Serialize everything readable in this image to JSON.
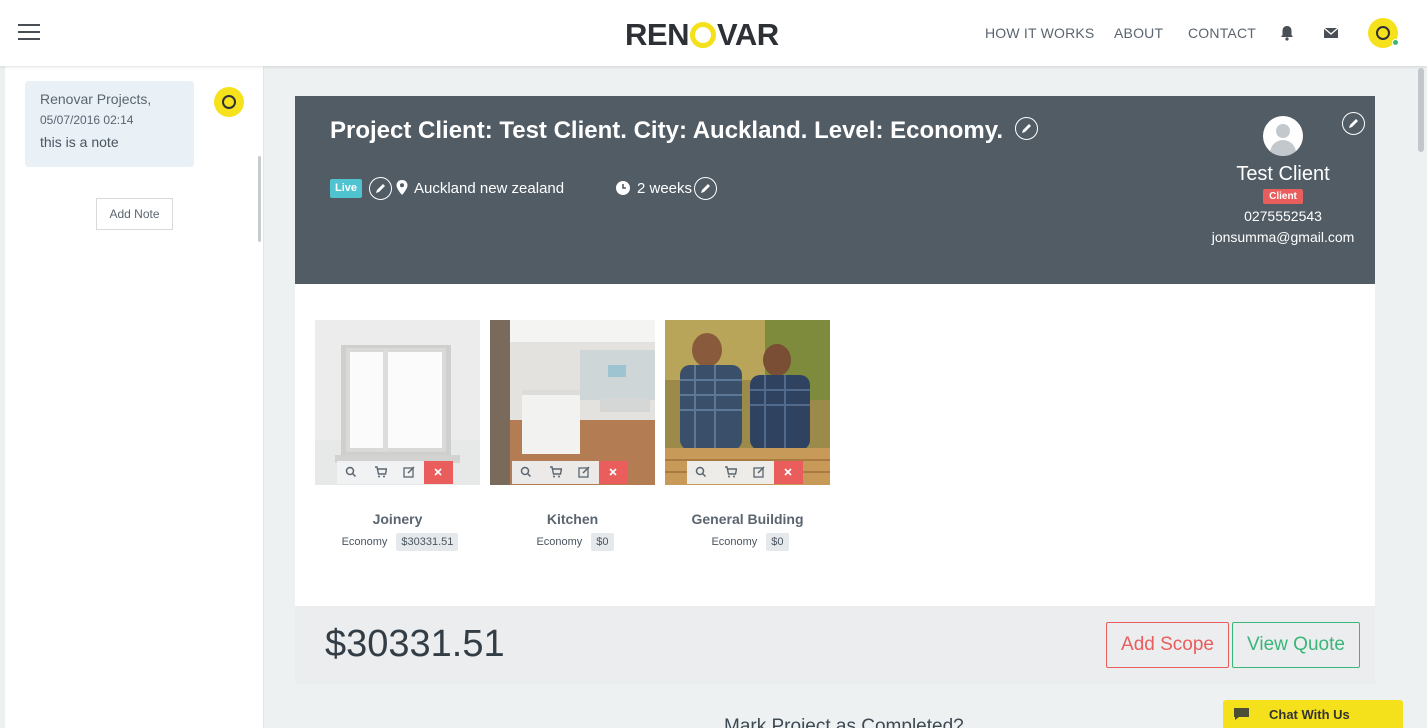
{
  "brand": {
    "logo_pre": "REN",
    "logo_post": "VAR"
  },
  "nav": {
    "links": [
      "HOW IT WORKS",
      "ABOUT",
      "CONTACT"
    ]
  },
  "sidebar": {
    "note": {
      "author": "Renovar Projects,",
      "date": "05/07/2016 02:14",
      "text": "this is a note"
    },
    "add_note_label": "Add Note"
  },
  "project": {
    "title": "Project Client: Test Client. City: Auckland. Level: Economy.",
    "status_badge": "Live",
    "location": "Auckland new zealand",
    "duration": "2 weeks",
    "client": {
      "name": "Test Client",
      "role_badge": "Client",
      "phone": "0275552543",
      "email": "jonsumma@gmail.com"
    }
  },
  "scopes": [
    {
      "name": "Joinery",
      "level": "Economy",
      "price": "$30331.51"
    },
    {
      "name": "Kitchen",
      "level": "Economy",
      "price": "$0"
    },
    {
      "name": "General Building",
      "level": "Economy",
      "price": "$0"
    }
  ],
  "totals": {
    "amount": "$30331.51",
    "add_scope_label": "Add Scope",
    "view_quote_label": "View Quote"
  },
  "footer": {
    "mark_complete": "Mark Project as Completed?",
    "chat_label": "Chat With Us"
  },
  "colors": {
    "brand_yellow": "#f4e11b",
    "header_bg": "#515c65",
    "accent_red": "#e95d5d",
    "accent_green": "#3bb57a",
    "live_teal": "#4fc3cf"
  }
}
